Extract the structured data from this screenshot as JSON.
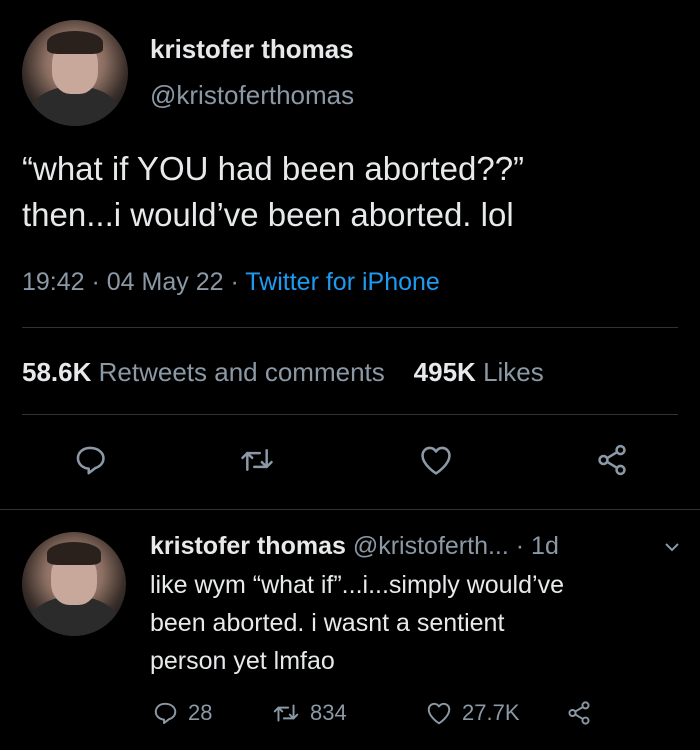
{
  "tweet": {
    "display_name": "kristofer thomas",
    "handle": "@kristoferthomas",
    "text_lines": [
      "“what if YOU had been aborted??”",
      "then...i would’ve been aborted. lol"
    ],
    "time": "19:42 · 04 May 22 · ",
    "source": "Twitter for iPhone",
    "retweets_count": "58.6K",
    "retweets_label": "Retweets and comments",
    "likes_count": "495K",
    "likes_label": "Likes"
  },
  "reply": {
    "display_name": "kristofer thomas",
    "handle": "@kristoferth...",
    "age": "· 1d",
    "text_lines": [
      "like wym “what if”...i...simply would’ve",
      "been aborted. i wasnt a sentient",
      "person yet lmfao"
    ],
    "reply_count": "28",
    "retweet_count": "834",
    "like_count": "27.7K"
  },
  "colors": {
    "background": "#000000",
    "text": "#e7e9ea",
    "secondary": "#8b98a5",
    "link": "#1d9bf0",
    "divider": "#2f3336"
  },
  "icons": [
    "reply-icon",
    "retweet-icon",
    "like-icon",
    "share-icon",
    "chevron-down-icon"
  ]
}
